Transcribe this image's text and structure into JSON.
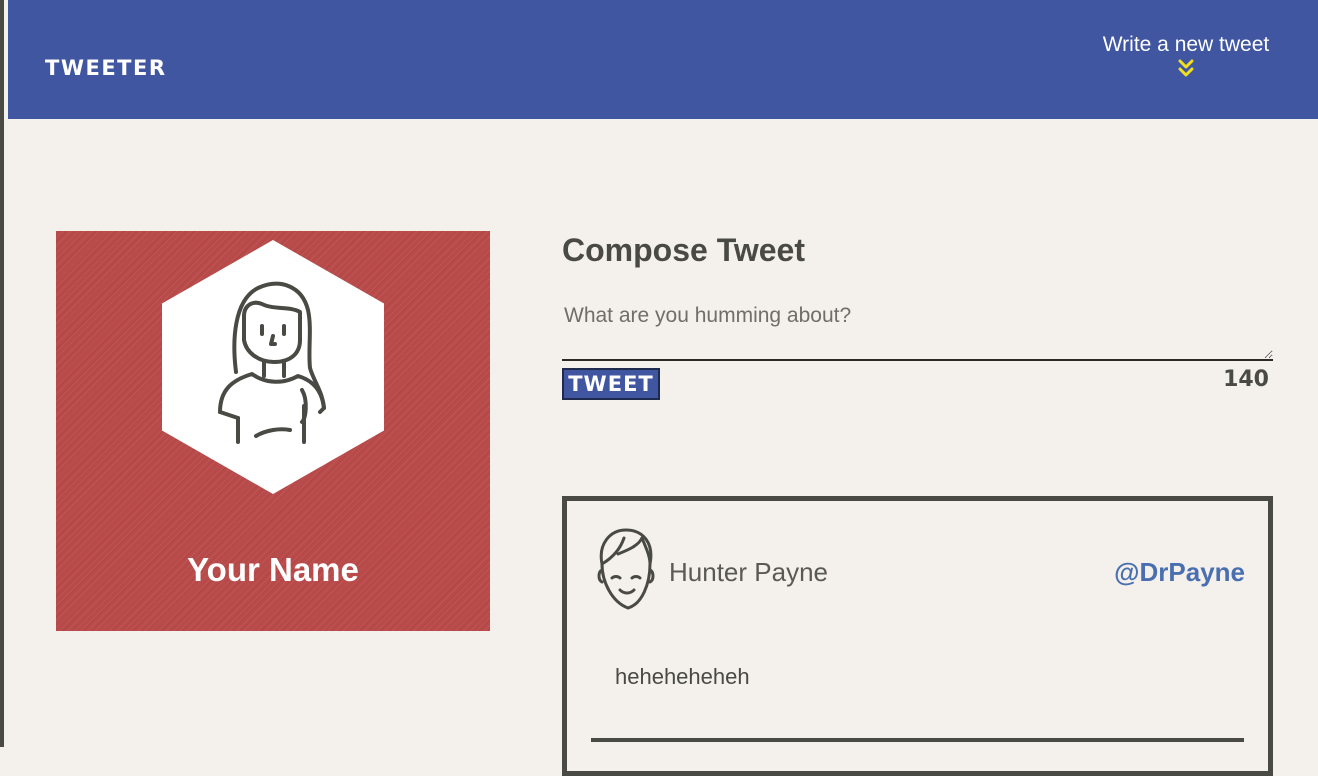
{
  "nav": {
    "brand": "TWEETER",
    "new_tweet_label": "Write a new tweet",
    "toggle_icon": "double-chevron-down-icon",
    "toggle_icon_color": "#f0e020"
  },
  "profile": {
    "name": "Your Name",
    "avatar_icon": "woman-avatar-icon",
    "background_color": "#b94a4a"
  },
  "compose": {
    "title": "Compose Tweet",
    "placeholder": "What are you humming about?",
    "value": "",
    "submit_label": "TWEET",
    "counter": "140"
  },
  "tweets": [
    {
      "avatar_icon": "man-avatar-icon",
      "name": "Hunter Payne",
      "handle": "@DrPayne",
      "text": "heheheheheh"
    }
  ],
  "colors": {
    "nav_bg": "#4056a1",
    "page_bg": "#f4f1ec",
    "text_dark": "#4a4a44",
    "handle_blue": "#4a6fb0"
  }
}
